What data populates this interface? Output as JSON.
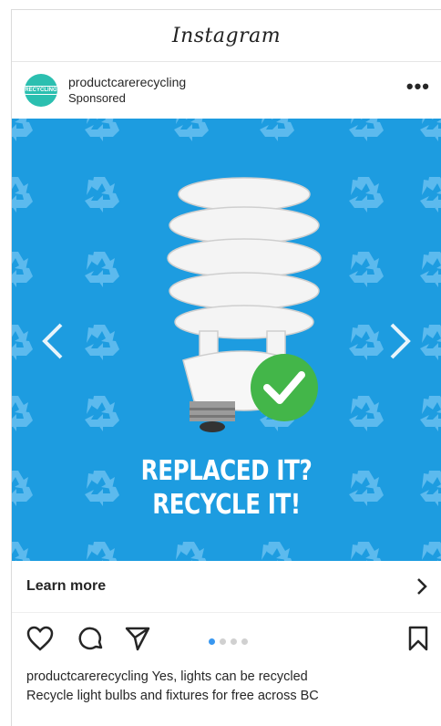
{
  "app": {
    "title": "Instagram"
  },
  "post": {
    "username": "productcarerecycling",
    "sponsored": "Sponsored",
    "avatar_text": "RECYCLING",
    "more": "•••",
    "media": {
      "headline_line1": "REPLACED IT?",
      "headline_line2": "RECYCLE IT!",
      "background_color": "#1d9ce0",
      "check_color": "#43b649"
    },
    "cta": {
      "label": "Learn more"
    },
    "carousel": {
      "total": 4,
      "active": 1
    },
    "caption": {
      "username": "productcarerecycling",
      "line1": "Yes, lights can be recycled",
      "line2": "Recycle light bulbs and fixtures for free across BC"
    }
  }
}
